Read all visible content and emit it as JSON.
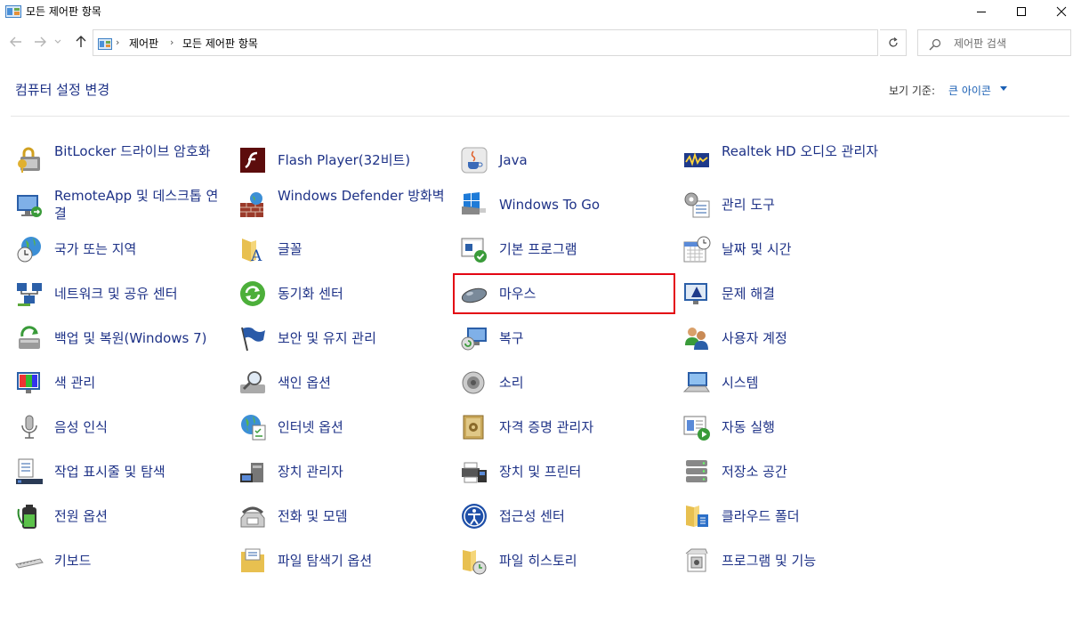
{
  "window": {
    "title": "모든 제어판 항목"
  },
  "address": {
    "crumbs": [
      "제어판",
      "모든 제어판 항목"
    ],
    "search_placeholder": "제어판 검색"
  },
  "header": {
    "title": "컴퓨터 설정 변경",
    "view_by_label": "보기 기준:",
    "view_by_value": "큰 아이콘"
  },
  "columns": [
    [
      "BitLocker 드라이브 암호화",
      "RemoteApp 및 데스크톱 연결",
      "국가 또는 지역",
      "네트워크 및 공유 센터",
      "백업 및 복원(Windows 7)",
      "색 관리",
      "음성 인식",
      "작업 표시줄 및 탐색",
      "전원 옵션",
      "키보드"
    ],
    [
      "Flash Player(32비트)",
      "Windows Defender 방화벽",
      "글꼴",
      "동기화 센터",
      "보안 및 유지 관리",
      "색인 옵션",
      "인터넷 옵션",
      "장치 관리자",
      "전화 및 모뎀",
      "파일 탐색기 옵션"
    ],
    [
      "Java",
      "Windows To Go",
      "기본 프로그램",
      "마우스",
      "복구",
      "소리",
      "자격 증명 관리자",
      "장치 및 프린터",
      "접근성 센터",
      "파일 히스토리"
    ],
    [
      "Realtek HD 오디오 관리자",
      "관리 도구",
      "날짜 및 시간",
      "문제 해결",
      "사용자 계정",
      "시스템",
      "자동 실행",
      "저장소 공간",
      "클라우드 폴더",
      "프로그램 및 기능"
    ]
  ],
  "highlighted_item": "마우스"
}
